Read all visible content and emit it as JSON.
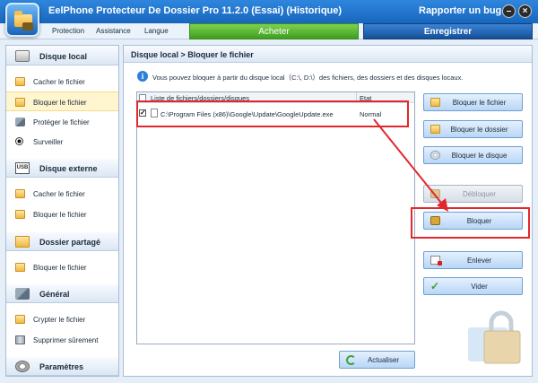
{
  "window": {
    "title": "EelPhone Protecteur De Dossier Pro 11.2.0 (Essai) (Historique)",
    "report_bug": "Rapporter un bug",
    "minimize_symbol": "–",
    "close_symbol": "×"
  },
  "menu": {
    "items": [
      "Protection",
      "Assistance",
      "Langue"
    ],
    "buy_button": "Acheter",
    "register_button": "Enregistrer"
  },
  "sidebar": {
    "sections": [
      {
        "header": "Disque local",
        "icon": "drive-icon",
        "items": [
          {
            "label": "Cacher le fichier",
            "icon": "folder-icon",
            "selected": false
          },
          {
            "label": "Bloquer le fichier",
            "icon": "folder-icon",
            "selected": true
          },
          {
            "label": "Protéger le fichier",
            "icon": "tools-icon",
            "selected": false
          },
          {
            "label": "Surveiller",
            "icon": "eye-icon",
            "selected": false
          }
        ]
      },
      {
        "header": "Disque externe",
        "icon": "usb-icon",
        "items": [
          {
            "label": "Cacher le fichier",
            "icon": "folder-icon",
            "selected": false
          },
          {
            "label": "Bloquer le fichier",
            "icon": "folder-icon",
            "selected": false
          }
        ]
      },
      {
        "header": "Dossier partagé",
        "icon": "folder-icon",
        "items": [
          {
            "label": "Bloquer le fichier",
            "icon": "folder-icon",
            "selected": false
          }
        ]
      },
      {
        "header": "Général",
        "icon": "tools-icon",
        "items": [
          {
            "label": "Crypter le fichier",
            "icon": "folder-icon",
            "selected": false
          },
          {
            "label": "Supprimer sûrement",
            "icon": "bin-icon",
            "selected": false
          }
        ]
      },
      {
        "header": "Paramètres",
        "icon": "gear-icon",
        "items": []
      }
    ]
  },
  "main": {
    "breadcrumb": "Disque local > Bloquer le fichier",
    "info_text": "Vous pouvez bloquer à partir du disque local（C:\\, D:\\）des fichiers, des dossiers et des disques locaux.",
    "list": {
      "col_name": "Liste de fichiers/dossiers/disques",
      "col_state": "Etat",
      "rows": [
        {
          "checked": true,
          "path": "C:\\Program Files (x86)\\Google\\Update\\GoogleUpdate.exe",
          "state": "Normal"
        }
      ]
    },
    "buttons": {
      "lock_file": "Bloquer le fichier",
      "lock_folder": "Bloquer le dossier",
      "lock_disk": "Bloquer le disque",
      "unlock": "Débloquer",
      "lock": "Bloquer",
      "remove": "Enlever",
      "clear": "Vider",
      "refresh": "Actualiser"
    },
    "check_mark": "✓"
  },
  "colors": {
    "accent_blue": "#1766bd",
    "buy_green": "#3e9e1f",
    "highlight_red": "#e2282c"
  }
}
